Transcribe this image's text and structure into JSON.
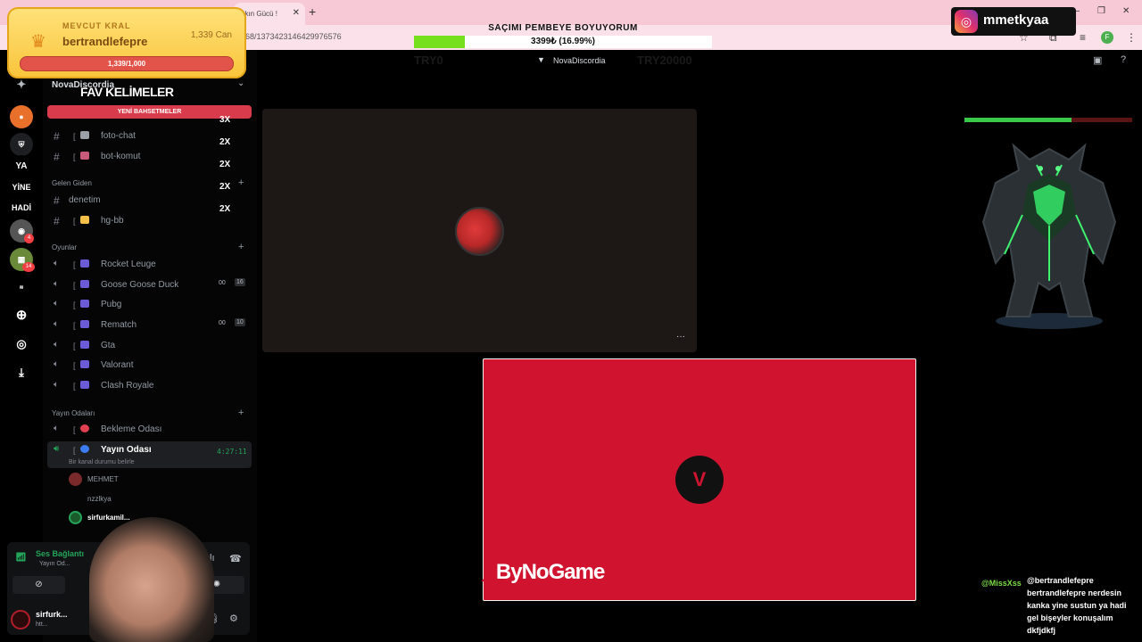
{
  "browser": {
    "tab_partial_title": "ğkın Gücü !",
    "url": "568/1373423146429976576",
    "profile_initial": "F"
  },
  "king_overlay": {
    "title": "MEVCUT KRAL",
    "name": "bertrandlefepre",
    "can_label": "1,339 Can",
    "hp_text": "1,339/1,000"
  },
  "goal": {
    "title": "SAÇIMI PEMBEYE BOYUYORUM",
    "progress_text": "3399₺ (16.99%)",
    "progress_fraction": 0.1699,
    "fill_color": "#76e01e"
  },
  "instagram": {
    "handle": "mmetkyaa"
  },
  "topbar": {
    "server_title": "NovaDiscordia",
    "try_left": "TRY0",
    "try_right": "TRY20000"
  },
  "server_rail": {
    "items": [
      {
        "label": "",
        "icon": "discord-icon"
      },
      {
        "label": "",
        "icon": "server-orange-icon"
      },
      {
        "label": "",
        "icon": "server-shield-icon"
      },
      {
        "label": "YA",
        "icon": "server-ya-icon"
      },
      {
        "label": "YİNE",
        "icon": "server-yine-icon"
      },
      {
        "label": "HADİ",
        "icon": "server-hadi-icon"
      },
      {
        "label": "",
        "icon": "server-4-icon",
        "badge": "4"
      },
      {
        "label": "",
        "icon": "server-14-icon",
        "badge": "14"
      },
      {
        "label": "",
        "icon": "server-text-icon"
      },
      {
        "label": "",
        "icon": "add-server-icon"
      },
      {
        "label": "",
        "icon": "explore-icon"
      },
      {
        "label": "",
        "icon": "download-icon"
      }
    ]
  },
  "sidebar": {
    "server_name": "NovaDiscordia",
    "fav_overlay": "FAV KELİMELER",
    "new_bets": "YENİ BAHSETMELER",
    "multipliers": [
      "3X",
      "2X",
      "2X",
      "2X",
      "2X"
    ],
    "text_channels": [
      {
        "label": "foto-chat"
      },
      {
        "label": "bot-komut"
      }
    ],
    "category_incoming": "Gelen Giden",
    "incoming_channels": [
      {
        "label": "denetim"
      },
      {
        "label": "hg-bb"
      }
    ],
    "category_games": "Oyunlar",
    "game_channels": [
      {
        "label": "Rocket Leuge"
      },
      {
        "label": "Goose Goose Duck",
        "count_a": "00",
        "count_b": "16"
      },
      {
        "label": "Pubg"
      },
      {
        "label": "Rematch",
        "count_a": "00",
        "count_b": "10"
      },
      {
        "label": "Gta"
      },
      {
        "label": "Valorant"
      },
      {
        "label": "Clash Royale"
      }
    ],
    "category_stream": "Yayın Odaları",
    "stream_channels": [
      {
        "label": "Bekleme Odası"
      },
      {
        "label": "Yayın Odası",
        "time": "4:27:11",
        "status": "Bir kanal durumu belirle"
      }
    ],
    "voice_users": [
      {
        "name": "MEHMET"
      },
      {
        "name": "nzzlkya"
      },
      {
        "name": "sirfurkamil..."
      }
    ]
  },
  "voice_panel": {
    "connection": "Ses Bağlantı",
    "room": "Yayın Od...",
    "username": "sirfurk...",
    "sub": "htt..."
  },
  "stage": {
    "tile_more": "···",
    "sponsor": "ByNoGame",
    "boss_hp_fraction": 0.64
  },
  "chat": {
    "user": "@MissXss",
    "message": "@bertrandlefepre bertrandlefepre nerdesin kanka yine sustun ya hadi gel bişeyler konuşalım dkfjdkfj"
  }
}
